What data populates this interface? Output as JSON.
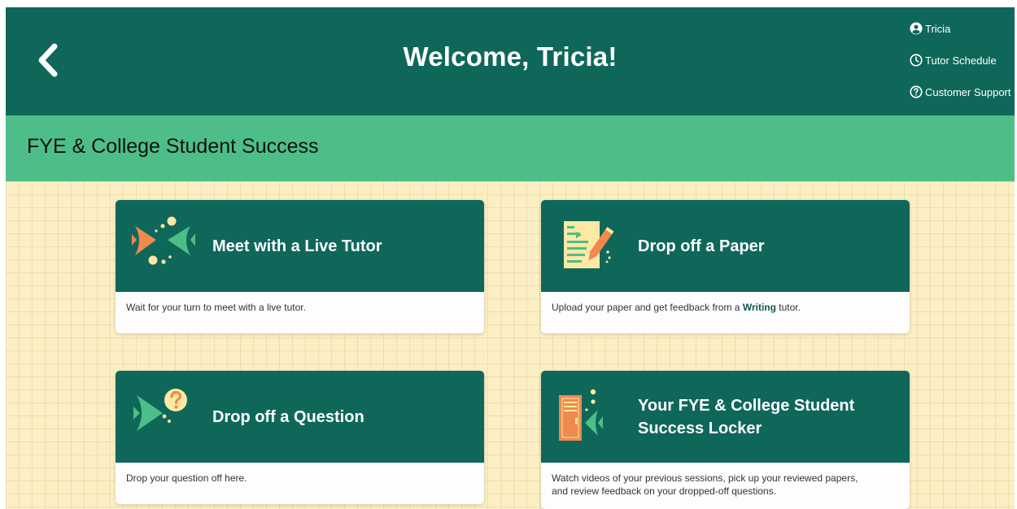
{
  "header": {
    "welcome": "Welcome, Tricia!",
    "user_menu": [
      {
        "label": "Tricia",
        "icon": "account-circle-icon"
      },
      {
        "label": "Tutor Schedule",
        "icon": "clock-icon"
      },
      {
        "label": "Customer Support",
        "icon": "help-circle-icon"
      }
    ]
  },
  "subheader": {
    "title": "FYE & College Student Success"
  },
  "cards": [
    {
      "title": "Meet with a Live Tutor",
      "description": "Wait for your turn to meet with a live tutor.",
      "icon": "live-tutor-fish-icon"
    },
    {
      "title": "Drop off a Paper",
      "description_before": "Upload your paper and get feedback from a ",
      "description_bold": "Writing",
      "description_after": " tutor.",
      "icon": "paper-pencil-icon"
    },
    {
      "title": "Drop off a Question",
      "description": "Drop your question off here.",
      "icon": "question-fish-icon"
    },
    {
      "title": "Your FYE & College Student Success Locker",
      "description_line1": "Watch videos of your previous sessions, pick up your reviewed papers,",
      "description_line2": "and review feedback on your dropped-off questions.",
      "icon": "locker-icon"
    }
  ],
  "colors": {
    "header_bg": "#0f675a",
    "subheader_bg": "#4dbe88",
    "content_bg": "#fbefc3",
    "accent_orange": "#f0894e",
    "accent_green": "#4dbe88",
    "accent_yellow": "#fde8a4"
  }
}
